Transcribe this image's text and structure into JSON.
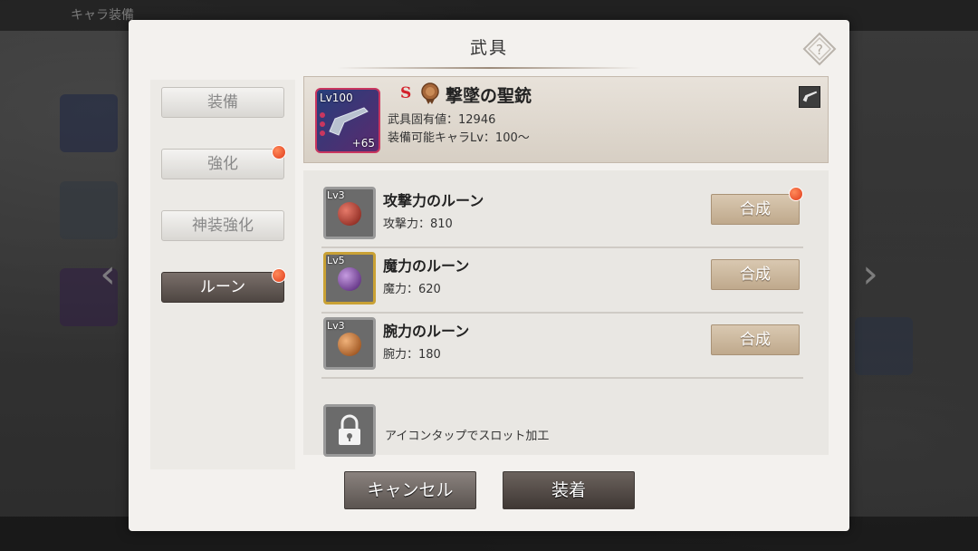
{
  "background": {
    "title": "キャラ装備"
  },
  "dialog": {
    "title": "武具"
  },
  "tabs": [
    {
      "label": "装備",
      "active": false,
      "badge": false
    },
    {
      "label": "強化",
      "active": false,
      "badge": true
    },
    {
      "label": "神装強化",
      "active": false,
      "badge": false
    },
    {
      "label": "ルーン",
      "active": true,
      "badge": true
    }
  ],
  "weapon": {
    "level": "Lv100",
    "plus": "+65",
    "rarity": "S",
    "name": "撃墜の聖銃",
    "unique_value": "武具固有値：12946",
    "equip_req": "装備可能キャラLv：100〜"
  },
  "runes": [
    {
      "level": "Lv3",
      "name": "攻撃力のルーン",
      "stat": "攻撃力：810",
      "button": "合成",
      "badge": true,
      "gem_color": "#c0392b"
    },
    {
      "level": "Lv5",
      "name": "魔力のルーン",
      "stat": "魔力：620",
      "button": "合成",
      "badge": false,
      "gem_color": "#8e44ad"
    },
    {
      "level": "Lv3",
      "name": "腕力のルーン",
      "stat": "腕力：180",
      "button": "合成",
      "badge": false,
      "gem_color": "#d35400"
    }
  ],
  "locked_slot": {
    "text": "アイコンタップでスロット加工"
  },
  "buttons": {
    "cancel": "キャンセル",
    "equip": "装着"
  },
  "colors": {
    "badge": "#e03c1c",
    "rarity": "#d3202a"
  }
}
